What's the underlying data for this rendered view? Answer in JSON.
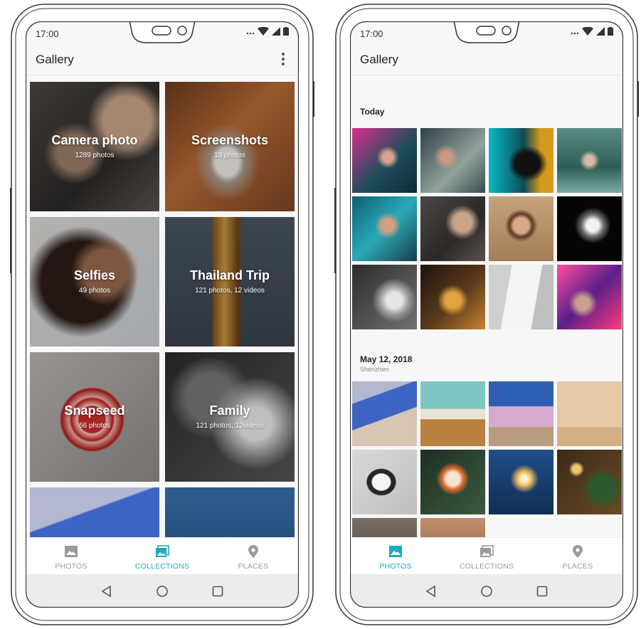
{
  "status": {
    "time": "17:00"
  },
  "left": {
    "app_title": "Gallery",
    "albums": [
      {
        "name": "Camera photo",
        "count": "1289 photos"
      },
      {
        "name": "Screenshots",
        "count": "19 photos"
      },
      {
        "name": "Selfies",
        "count": "49 photos"
      },
      {
        "name": "Thailand Trip",
        "count": "121 photos, 12 videos"
      },
      {
        "name": "Snapseed",
        "count": "66 photos"
      },
      {
        "name": "Family",
        "count": "121 photos, 12videos"
      }
    ],
    "nav": {
      "photos": "PHOTOS",
      "collections": "COLLECTIONS",
      "places": "PLACES",
      "active": "collections"
    }
  },
  "right": {
    "app_title": "Gallery",
    "sections": [
      {
        "title": "Today",
        "subtitle": ""
      },
      {
        "title": "May 12, 2018",
        "subtitle": "Shenzhen"
      }
    ],
    "nav": {
      "photos": "PHOTOS",
      "collections": "COLLECTIONS",
      "places": "PLACES",
      "active": "photos"
    }
  },
  "colors": {
    "accent": "#1aa9c0",
    "inactive": "#9a9a9a",
    "background": "#f7f7f7"
  },
  "icons": [
    "photo-icon",
    "collections-icon",
    "place-pin-icon",
    "back-icon",
    "home-icon",
    "recents-icon",
    "more-vert-icon",
    "signal-icon",
    "wifi-icon",
    "battery-icon"
  ]
}
